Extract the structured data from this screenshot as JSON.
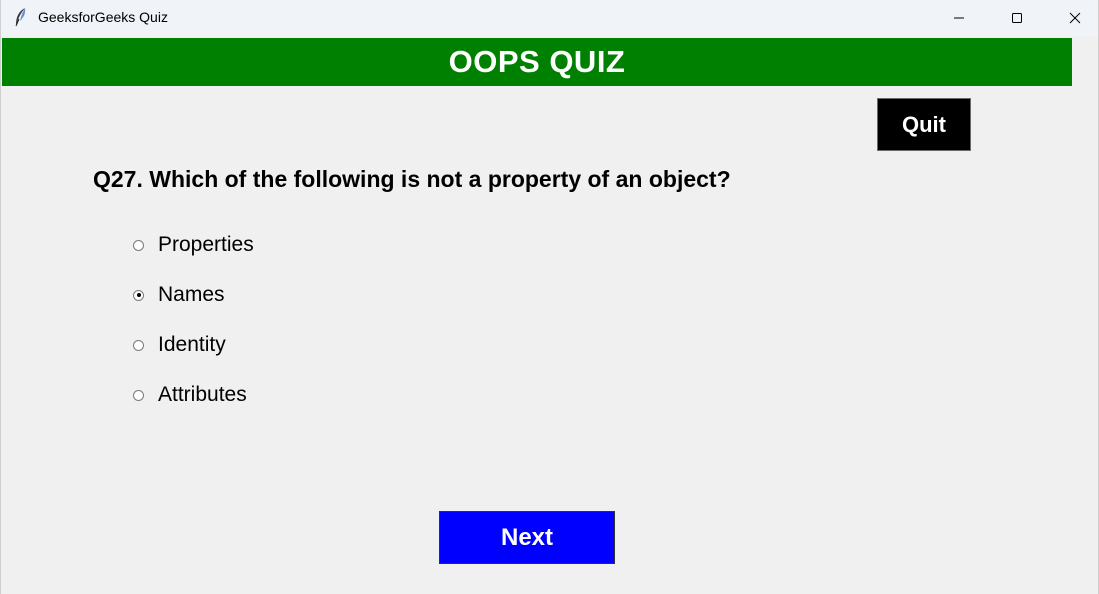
{
  "window": {
    "title": "GeeksforGeeks Quiz",
    "minimize_icon": "minimize-icon",
    "maximize_icon": "maximize-icon",
    "close_icon": "close-icon"
  },
  "banner": {
    "title": "OOPS QUIZ",
    "color": "#008000"
  },
  "quit": {
    "label": "Quit",
    "color": "#000000"
  },
  "question": {
    "text": "Q27. Which of the following is not a property of an object?"
  },
  "options": [
    {
      "label": "Properties",
      "selected": false
    },
    {
      "label": "Names",
      "selected": true
    },
    {
      "label": "Identity",
      "selected": false
    },
    {
      "label": "Attributes",
      "selected": false
    }
  ],
  "next": {
    "label": "Next",
    "color": "#0000ff"
  }
}
